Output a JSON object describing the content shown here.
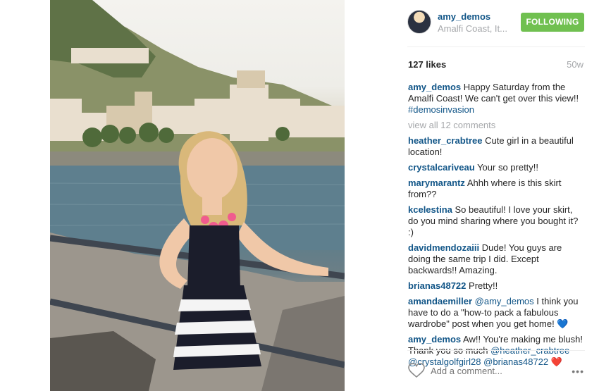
{
  "post": {
    "username": "amy_demos",
    "location": "Amalfi Coast, It...",
    "follow_label": "FOLLOWING",
    "likes": "127 likes",
    "age": "50w"
  },
  "caption": {
    "user": "amy_demos",
    "text": " Happy Saturday from the Amalfi Coast! We can't get over this view!! ",
    "hashtag": "#demosinvasion"
  },
  "view_all": "view all 12 comments",
  "comments": [
    {
      "user": "heather_crabtree",
      "text": " Cute girl in a beautiful location!"
    },
    {
      "user": "crystalcariveau",
      "text": " Your so pretty!!"
    },
    {
      "user": "marymarantz",
      "text": " Ahhh where is this skirt from??"
    },
    {
      "user": "kcelestina",
      "text": " So beautiful! I love your skirt, do you mind sharing where you bought it? :)"
    },
    {
      "user": "davidmendozaiii",
      "text": " Dude! You guys are doing the same trip I did. Except backwards!! Amazing."
    },
    {
      "user": "brianas48722",
      "text": " Pretty!!"
    }
  ],
  "comment_amanda": {
    "user": "amandaemiller",
    "mention": " @amy_demos",
    "text": " I think you have to do a \"how-to pack a fabulous wardrobe\" post when you get home! ",
    "emoji": "💙"
  },
  "comment_reply": {
    "user": "amy_demos",
    "text": " Aw!! You're making me blush! Thank you so much ",
    "mention1": "@heather_crabtree",
    "mention2": "@crystalgolfgirl28",
    "mention3": "@brianas48722",
    "emoji": "❤️"
  },
  "footer": {
    "placeholder": "Add a comment...",
    "more_icon": "•••"
  },
  "colors": {
    "link": "#125688",
    "follow_green": "#70c050",
    "muted": "#a5a7aa"
  },
  "icons": {
    "like": "heart-outline-icon",
    "more": "ellipsis-icon"
  }
}
